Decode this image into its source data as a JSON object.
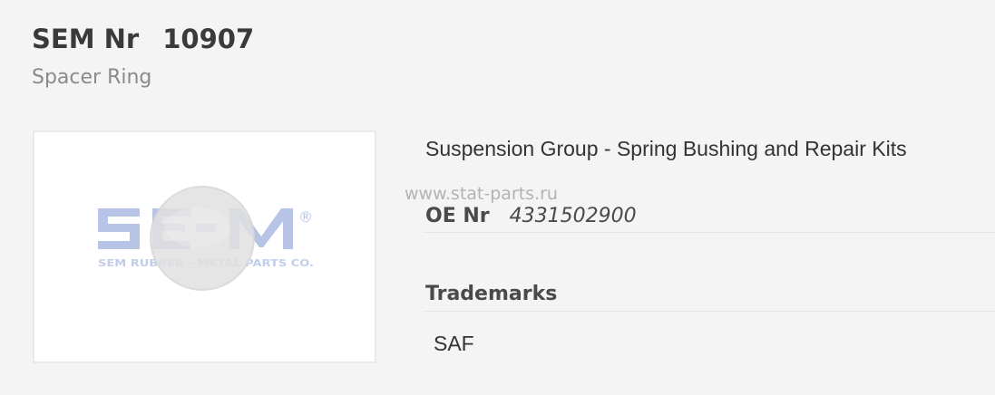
{
  "header": {
    "label": "SEM Nr",
    "number": "10907",
    "subtitle": "Spacer Ring"
  },
  "image": {
    "logo_text": "SEM RUBBER - METAL PARTS CO.",
    "logo_mark": "SE-M",
    "registered_mark": "®",
    "watermark": "www.stat-parts.ru"
  },
  "details": {
    "group": "Suspension Group - Spring Bushing and Repair Kits",
    "oe_label": "OE Nr",
    "oe_value": "4331502900",
    "trademarks_heading": "Trademarks",
    "trademarks": [
      "SAF"
    ]
  },
  "colors": {
    "logo_blue": "#b7c4e6",
    "ring": "#e2e2e2"
  }
}
